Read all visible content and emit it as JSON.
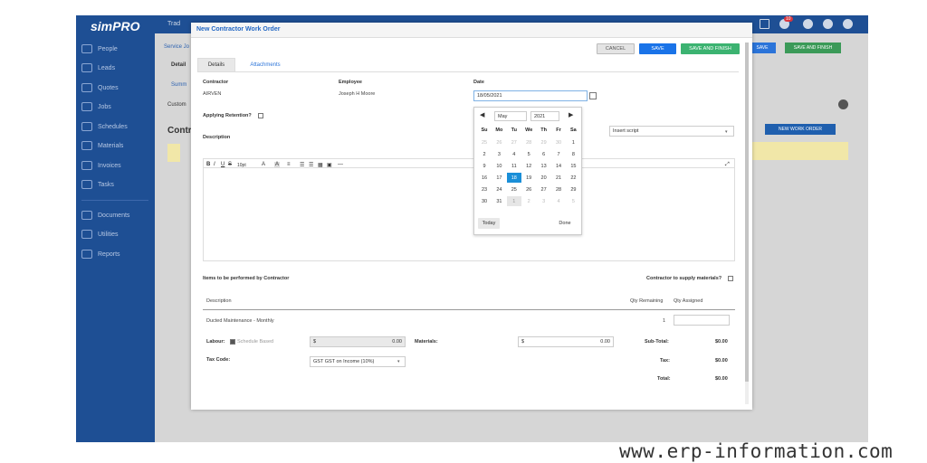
{
  "sidebar": {
    "logo": "simPRO",
    "items": [
      {
        "label": "People"
      },
      {
        "label": "Leads"
      },
      {
        "label": "Quotes"
      },
      {
        "label": "Jobs"
      },
      {
        "label": "Schedules"
      },
      {
        "label": "Materials"
      },
      {
        "label": "Invoices"
      },
      {
        "label": "Tasks"
      },
      {
        "label": "Documents"
      },
      {
        "label": "Utilities"
      },
      {
        "label": "Reports"
      }
    ]
  },
  "background": {
    "breadcrumb": "Trad",
    "service_link": "Service Jo",
    "details_tab": "Detail",
    "summary_link": "Summ",
    "customer_label": "Custom",
    "contractors_heading": "Contr",
    "save_label": "SAVE",
    "save_finish_label": "SAVE AND FINISH",
    "new_work_order_label": "NEW WORK ORDER",
    "notification_count": "10"
  },
  "modal": {
    "title": "New Contractor Work Order",
    "cancel_label": "CANCEL",
    "save_label": "SAVE",
    "save_finish_label": "SAVE AND FINISH",
    "tabs": [
      {
        "label": "Details"
      },
      {
        "label": "Attachments"
      }
    ],
    "contractor_label": "Contractor",
    "contractor_value": "AIRVEN",
    "employee_label": "Employee",
    "employee_value": "Joseph H Moore",
    "date_label": "Date",
    "date_value": "18/05/2021",
    "retention_label": "Applying Retention?",
    "description_label": "Description",
    "insert_script": "Insert script",
    "toolbar": {
      "font_size": "10pt"
    },
    "items_label": "Items to be performed by Contractor",
    "supply_label": "Contractor to supply materials?",
    "table": {
      "col_description": "Description",
      "col_qty_remaining": "Qty Remaining",
      "col_qty_assigned": "Qty Assigned",
      "row_description": "Ducted Maintenance - Monthly",
      "row_qty_remaining": "1"
    },
    "labour_label": "Labour:",
    "schedule_based": "Schedule Based",
    "labour_currency": "$",
    "labour_value": "0.00",
    "materials_label": "Materials:",
    "materials_currency": "$",
    "materials_value": "0.00",
    "subtotal_label": "Sub-Total:",
    "subtotal_value": "$0.00",
    "taxcode_label": "Tax Code:",
    "taxcode_value": "GST GST on Income (10%)",
    "tax_label": "Tax:",
    "tax_value": "$0.00",
    "total_label": "Total:",
    "total_value": "$0.00"
  },
  "calendar": {
    "month": "May",
    "year": "2021",
    "weekdays": [
      "Su",
      "Mo",
      "Tu",
      "We",
      "Th",
      "Fr",
      "Sa"
    ],
    "weeks": [
      [
        "25",
        "26",
        "27",
        "28",
        "29",
        "30",
        "1"
      ],
      [
        "2",
        "3",
        "4",
        "5",
        "6",
        "7",
        "8"
      ],
      [
        "9",
        "10",
        "11",
        "12",
        "13",
        "14",
        "15"
      ],
      [
        "16",
        "17",
        "18",
        "19",
        "20",
        "21",
        "22"
      ],
      [
        "23",
        "24",
        "25",
        "26",
        "27",
        "28",
        "29"
      ],
      [
        "30",
        "31",
        "1",
        "2",
        "3",
        "4",
        "5"
      ]
    ],
    "today_label": "Today",
    "done_label": "Done"
  },
  "watermark": "www.erp-information.com",
  "colors": {
    "sidebar": "#1e4f94",
    "primary": "#1a73e8",
    "success": "#3cb371",
    "selected_day": "#1a8fd8"
  }
}
